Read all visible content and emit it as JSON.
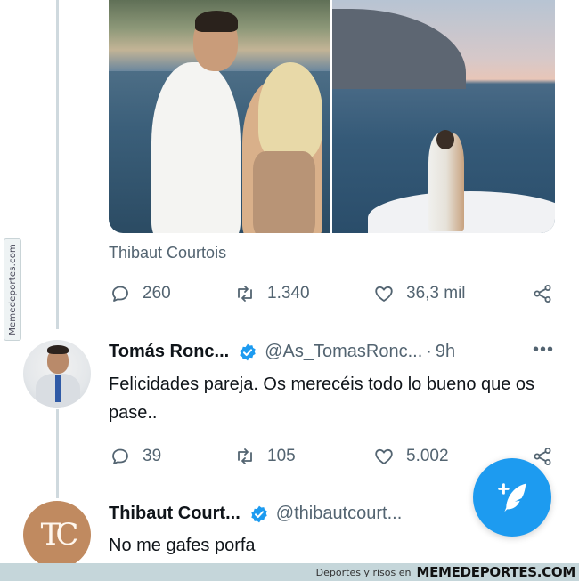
{
  "tweet_main": {
    "author_name": "Thibaut Courtois",
    "stats": {
      "replies": "260",
      "retweets": "1.340",
      "likes": "36,3 mil"
    }
  },
  "reply_1": {
    "display_name": "Tomás Ronc...",
    "handle": "@As_TomasRonc...",
    "separator": "·",
    "time": "9h",
    "more": "•••",
    "text": "Felicidades pareja. Os merecéis todo lo bueno que os pase..",
    "stats": {
      "replies": "39",
      "retweets": "105",
      "likes": "5.002"
    }
  },
  "reply_2": {
    "display_name": "Thibaut Court...",
    "handle": "@thibautcourt...",
    "text": "No me gafes porfa",
    "avatar_monogram": "TC"
  },
  "watermark": {
    "side_text": "Memedeportes.com",
    "bottom_small": "Deportes y risos en",
    "bottom_brand": "MEMEDEPORTES.COM"
  },
  "icons": {
    "reply": "reply-icon",
    "retweet": "retweet-icon",
    "like": "heart-icon",
    "share": "share-icon",
    "verified": "verified-badge-icon",
    "compose": "compose-tweet-icon"
  },
  "colors": {
    "accent": "#1d9bf0",
    "secondary_text": "#536471",
    "thread_line": "#cfd9de",
    "watermark_bar": "#c5d6da"
  }
}
